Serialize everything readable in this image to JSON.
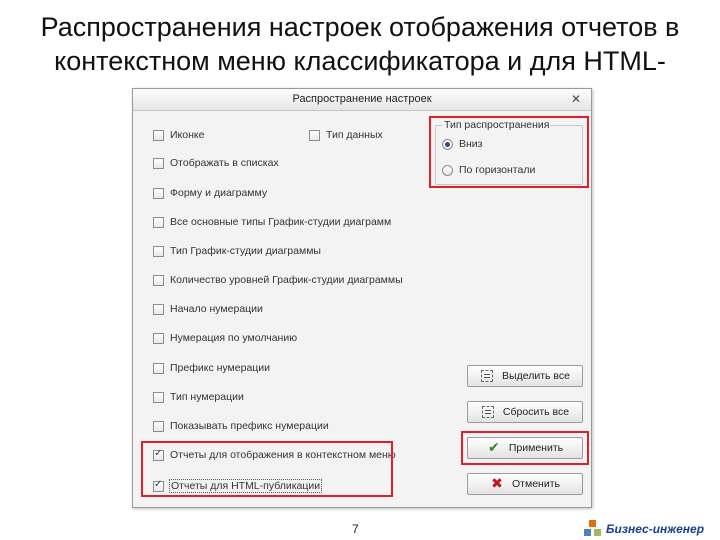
{
  "slide": {
    "title": "Распространения настроек отображения отчетов в контекстном меню классификатора и для HTML-",
    "page_number": "7",
    "brand": "Бизнес-инженер"
  },
  "dialog": {
    "title": "Распространение настроек",
    "close_glyph": "✕",
    "checkboxes": [
      {
        "label": "Иконке",
        "checked": false
      },
      {
        "label": "Тип данных",
        "checked": false
      },
      {
        "label": "Отображать в списках",
        "checked": false
      },
      {
        "label": "Форму и диаграмму",
        "checked": false
      },
      {
        "label": "Все основные типы График-студии диаграмм",
        "checked": false
      },
      {
        "label": "Тип График-студии диаграммы",
        "checked": false
      },
      {
        "label": "Количество уровней График-студии диаграммы",
        "checked": false
      },
      {
        "label": "Начало нумерации",
        "checked": false
      },
      {
        "label": "Нумерация по умолчанию",
        "checked": false
      },
      {
        "label": "Префикс нумерации",
        "checked": false
      },
      {
        "label": "Тип нумерации",
        "checked": false
      },
      {
        "label": "Показывать префикс нумерации",
        "checked": false
      },
      {
        "label": "Отчеты для отображения в контекстном меню",
        "checked": true
      },
      {
        "label": "Отчеты для HTML-публикации",
        "checked": true
      }
    ],
    "group": {
      "legend": "Тип распространения",
      "options": [
        {
          "label": "Вниз",
          "checked": true
        },
        {
          "label": "По горизонтали",
          "checked": false
        }
      ]
    },
    "buttons": {
      "select_all": "Выделить все",
      "reset_all": "Сбросить все",
      "apply": "Применить",
      "cancel": "Отменить"
    }
  },
  "colors": {
    "highlight": "#e01f26",
    "brand": "#1b3f8f",
    "apply_icon": "#2a8a1f",
    "cancel_icon": "#c0141b"
  },
  "icons": {
    "close": "close-icon",
    "select_all": "select-all-icon",
    "reset_all": "reset-all-icon",
    "apply": "checkmark-icon",
    "cancel": "cross-icon",
    "brand": "brand-logo-icon"
  }
}
